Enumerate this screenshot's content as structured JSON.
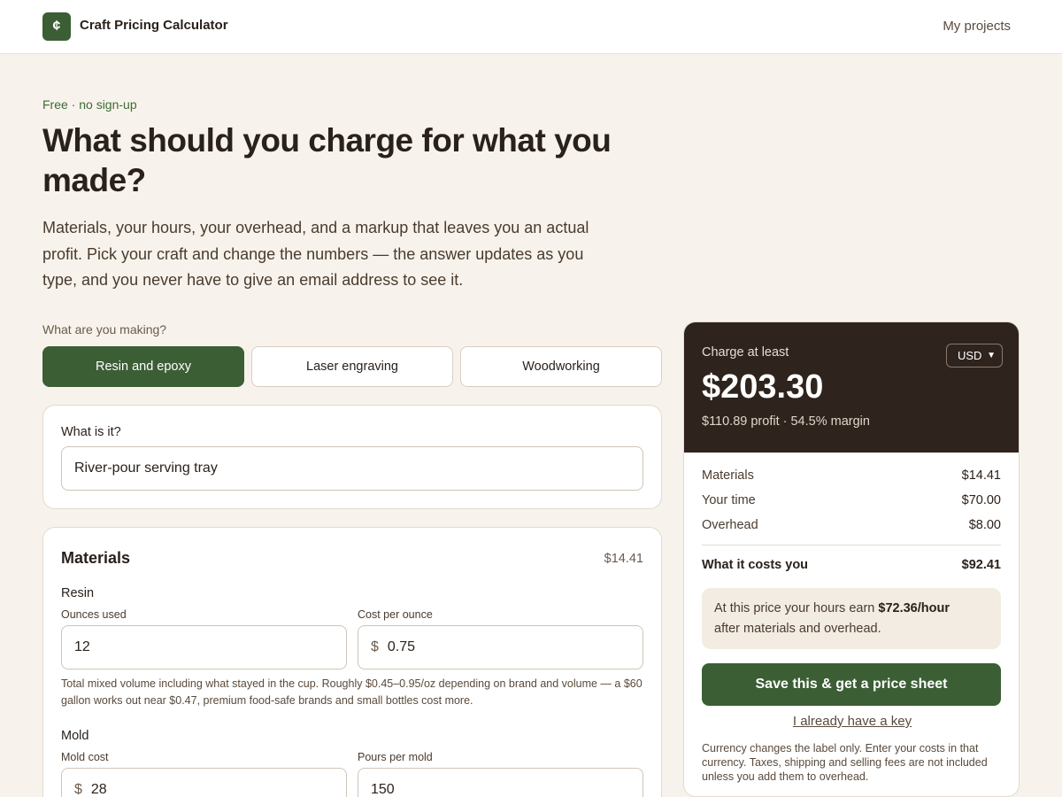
{
  "header": {
    "logo_glyph": "¢",
    "title": "Craft Pricing Calculator",
    "nav_link": "My projects"
  },
  "hero": {
    "eyebrow": "Free · no sign-up",
    "title": "What should you charge for what you made?",
    "subtitle": "Materials, your hours, your overhead, and a markup that leaves you an actual profit. Pick your craft and change the numbers — the answer updates as you type, and you never have to give an email address to see it."
  },
  "craft_picker": {
    "label": "What are you making?",
    "options": [
      "Resin and epoxy",
      "Laser engraving",
      "Woodworking"
    ],
    "selected": "Resin and epoxy"
  },
  "item": {
    "label": "What is it?",
    "value": "River‑pour serving tray"
  },
  "materials": {
    "title": "Materials",
    "total": "$14.41",
    "resin": {
      "label": "Resin",
      "ounces_label": "Ounces used",
      "ounces_value": "12",
      "cost_label": "Cost per ounce",
      "cost_prefix": "$",
      "cost_value": "0.75",
      "help": "Total mixed volume including what stayed in the cup. Roughly $0.45–0.95/oz depending on brand and volume — a $60 gallon works out near $0.47, premium food-safe brands and small bottles cost more."
    },
    "mold": {
      "label": "Mold",
      "cost_label": "Mold cost",
      "cost_prefix": "$",
      "cost_value": "28",
      "pours_label": "Pours per mold",
      "pours_value": "150"
    }
  },
  "result": {
    "label": "Charge at least",
    "currency": "USD",
    "price": "$203.30",
    "profit_line": "$110.89 profit · 54.5% margin",
    "breakdown": [
      {
        "label": "Materials",
        "value": "$14.41"
      },
      {
        "label": "Your time",
        "value": "$70.00"
      },
      {
        "label": "Overhead",
        "value": "$8.00"
      }
    ],
    "total_label": "What it costs you",
    "total_value": "$92.41",
    "earn_prefix": "At this price your hours earn",
    "earn_rate": "$72.36/hour",
    "earn_suffix": "after materials and overhead.",
    "save_button": "Save this & get a price sheet",
    "key_link": "I already have a key",
    "note": "Currency changes the label only. Enter your costs in that currency. Taxes, shipping and selling fees are not included unless you add them to overhead."
  },
  "colors": {
    "accent": "#3b5e35",
    "dark_panel": "#2e231d",
    "background": "#f7f3ec"
  }
}
